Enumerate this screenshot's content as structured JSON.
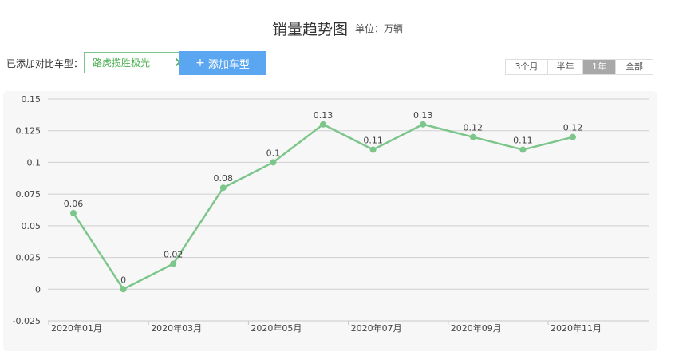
{
  "header": {
    "title": "销量趋势图",
    "unit": "单位：万辆"
  },
  "compare": {
    "label": "已添加对比车型：",
    "tag_label": "路虎揽胜极光",
    "add_label": "添加车型",
    "add_plus": "+"
  },
  "range_tabs": [
    {
      "label": "3个月",
      "active": false
    },
    {
      "label": "半年",
      "active": false
    },
    {
      "label": "1年",
      "active": true
    },
    {
      "label": "全部",
      "active": false
    }
  ],
  "colors": {
    "series": "#7cc68b",
    "accent_button": "#5aa6f0",
    "active_tab": "#a8a8a8"
  },
  "chart_data": {
    "type": "line",
    "title": "销量趋势图",
    "ylim": [
      -0.025,
      0.15
    ],
    "yticks": [
      "0.15",
      "0.125",
      "0.1",
      "0.075",
      "0.05",
      "0.025",
      "0",
      "-0.025"
    ],
    "ytick_values": [
      0.15,
      0.125,
      0.1,
      0.075,
      0.05,
      0.025,
      0,
      -0.025
    ],
    "xtick_labels": [
      "2020年01月",
      "2020年03月",
      "2020年05月",
      "2020年07月",
      "2020年09月",
      "2020年11月"
    ],
    "xtick_index": [
      0,
      2,
      4,
      6,
      8,
      10
    ],
    "grid": true,
    "series": [
      {
        "values": [
          0.06,
          0,
          0.02,
          0.08,
          0.1,
          0.13,
          0.11,
          0.13,
          0.12,
          0.11,
          0.12
        ],
        "labels": [
          "0.06",
          "0",
          "0.02",
          "0.08",
          "0.1",
          "0.13",
          "0.11",
          "0.13",
          "0.12",
          "0.11",
          "0.12"
        ]
      }
    ]
  }
}
